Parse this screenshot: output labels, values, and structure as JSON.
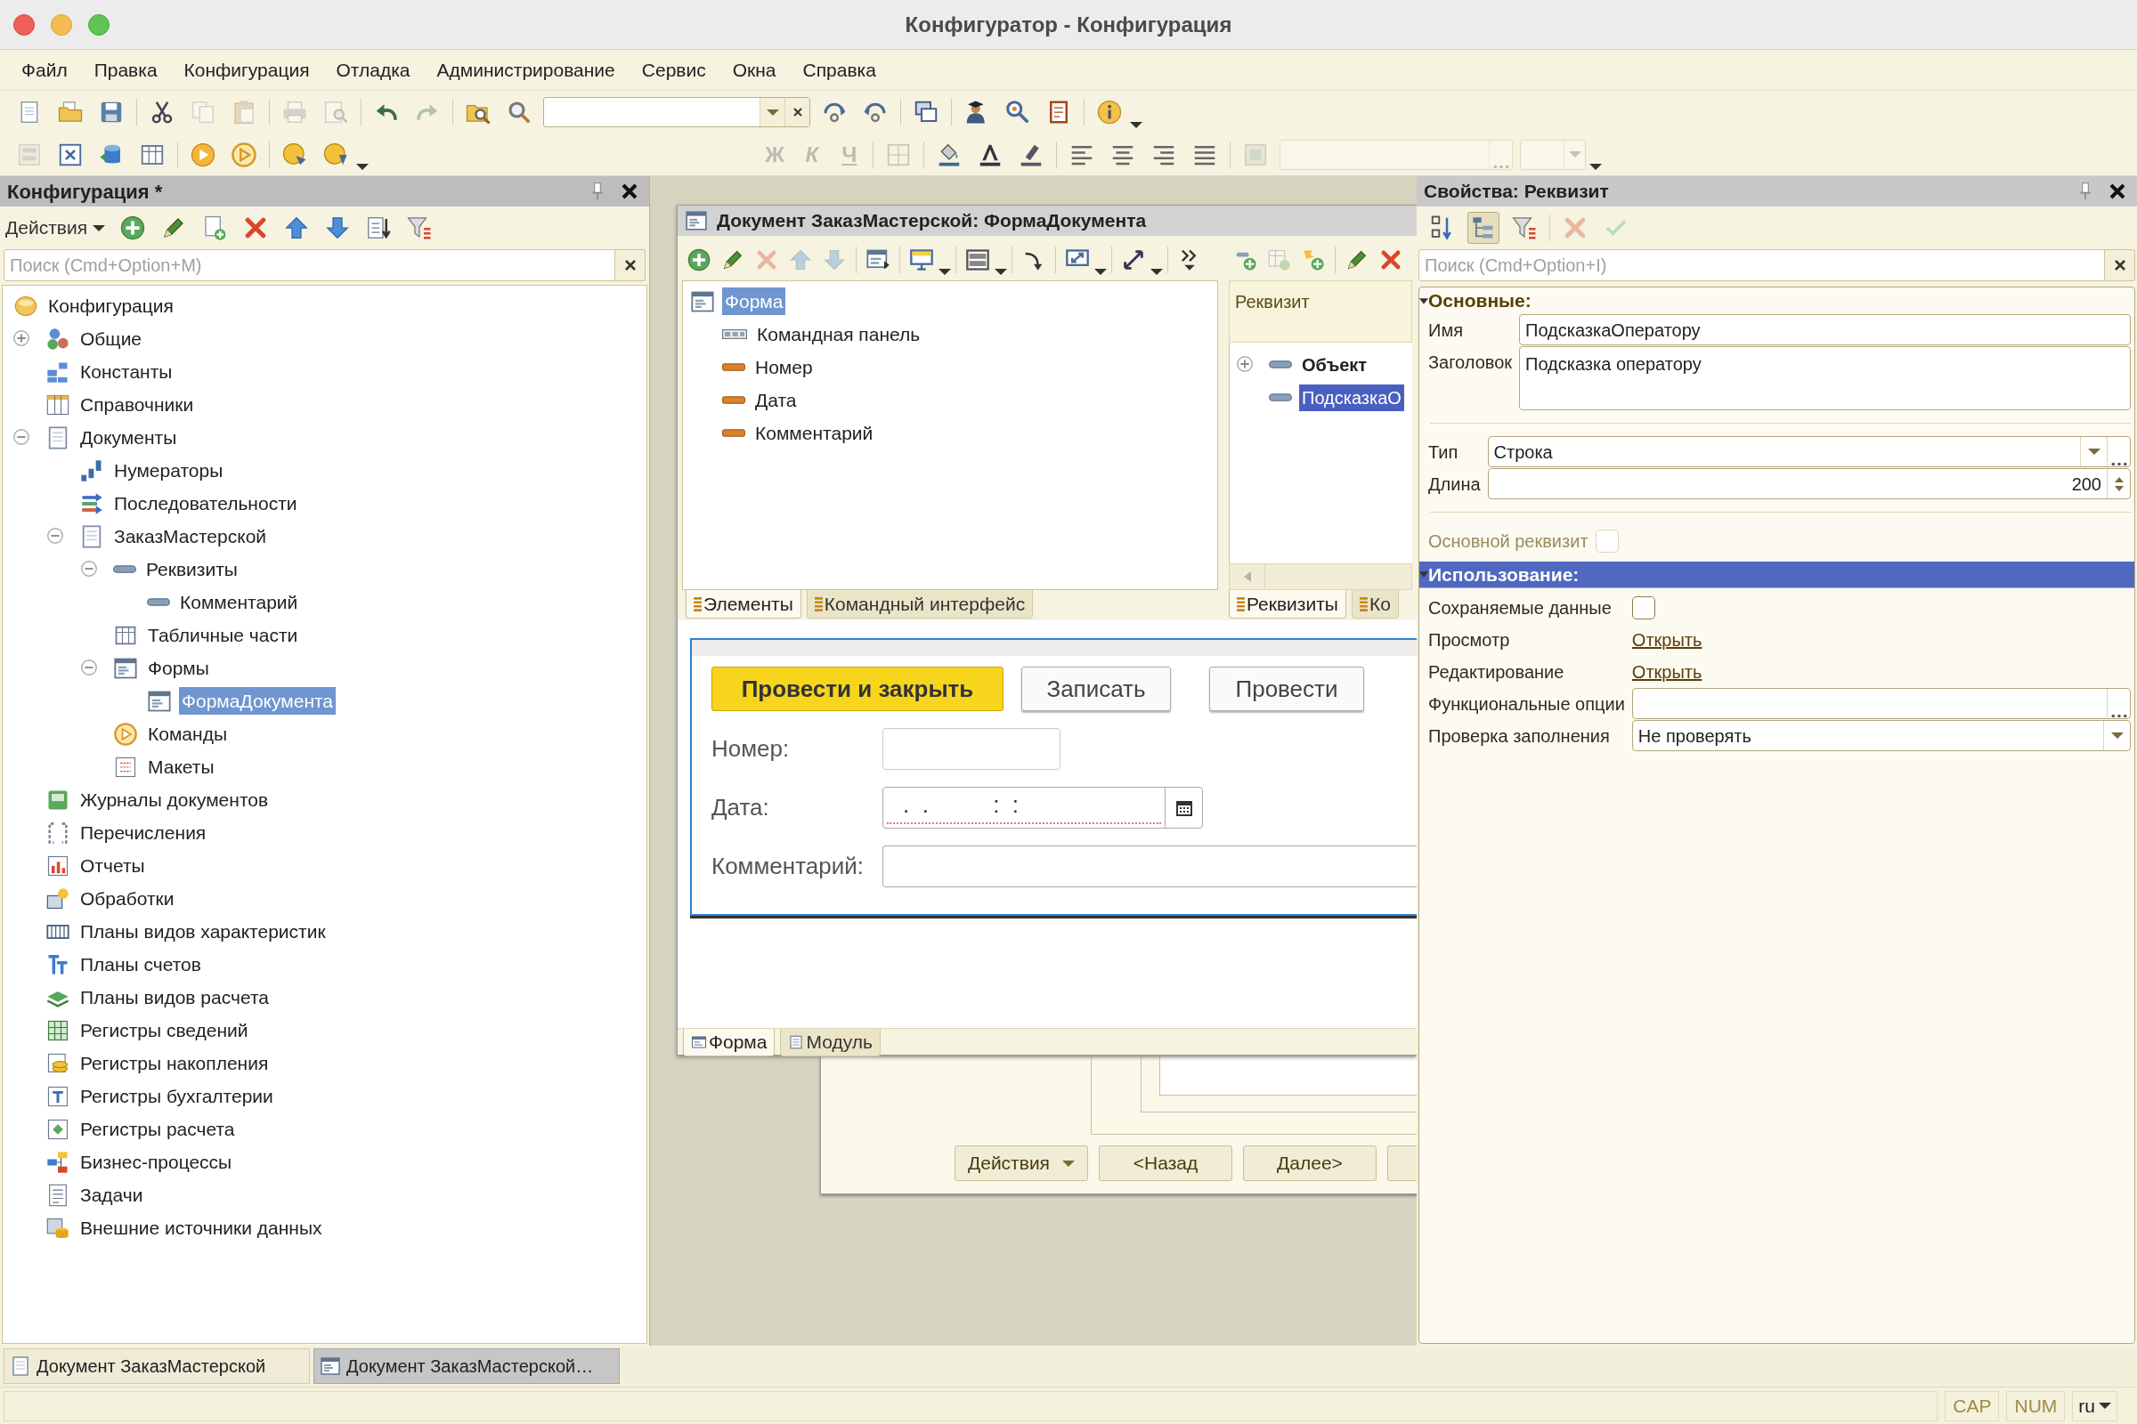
{
  "window": {
    "title": "Конфигуратор - Конфигурация"
  },
  "menu": [
    "Файл",
    "Правка",
    "Конфигурация",
    "Отладка",
    "Администрирование",
    "Сервис",
    "Окна",
    "Справка"
  ],
  "main_toolbar": [
    [
      {
        "kind": "new",
        "disabled": false
      },
      {
        "kind": "open",
        "disabled": false
      },
      {
        "kind": "save",
        "disabled": false
      }
    ],
    [
      {
        "kind": "cut",
        "disabled": false
      },
      {
        "kind": "copy",
        "disabled": true
      },
      {
        "kind": "paste",
        "disabled": true
      }
    ],
    [
      {
        "kind": "print",
        "disabled": true
      },
      {
        "kind": "preview",
        "disabled": true
      }
    ],
    [
      {
        "kind": "undo",
        "disabled": false
      },
      {
        "kind": "redo",
        "disabled": true
      }
    ],
    [
      {
        "kind": "folder-search",
        "disabled": false
      },
      {
        "kind": "search",
        "disabled": false
      },
      {
        "kind": "search-combo",
        "disabled": false
      },
      {
        "kind": "find-next",
        "disabled": false
      },
      {
        "kind": "find-prev",
        "disabled": false
      }
    ],
    [
      {
        "kind": "windows",
        "disabled": false
      }
    ],
    [
      {
        "kind": "person",
        "disabled": false
      },
      {
        "kind": "help",
        "disabled": false
      },
      {
        "kind": "book",
        "disabled": false
      }
    ],
    [
      {
        "kind": "info",
        "disabled": false
      },
      {
        "kind": "caret",
        "disabled": false
      }
    ]
  ],
  "format_toolbar": {
    "left": [
      [
        {
          "kind": "form-layout",
          "disabled": true
        },
        {
          "kind": "x-form",
          "disabled": false
        },
        {
          "kind": "db",
          "disabled": false
        },
        {
          "kind": "table",
          "disabled": false
        }
      ],
      [
        {
          "kind": "play",
          "disabled": false
        },
        {
          "kind": "play-outline",
          "disabled": false
        }
      ],
      [
        {
          "kind": "disc",
          "disabled": false
        },
        {
          "kind": "disc-down",
          "disabled": false
        },
        {
          "kind": "caret",
          "disabled": false
        }
      ]
    ],
    "right": [
      [
        {
          "kind": "bold",
          "text": "Ж",
          "disabled": true
        },
        {
          "kind": "italic",
          "text": "К",
          "disabled": true
        },
        {
          "kind": "underline",
          "text": "Ч",
          "disabled": true
        }
      ],
      [
        {
          "kind": "grid",
          "disabled": true
        }
      ],
      [
        {
          "kind": "bucket",
          "disabled": false
        },
        {
          "kind": "text-color",
          "disabled": false
        },
        {
          "kind": "highlighter",
          "disabled": false
        }
      ],
      [
        {
          "kind": "align-left",
          "disabled": false
        },
        {
          "kind": "align-center",
          "disabled": false
        },
        {
          "kind": "align-right",
          "disabled": false
        },
        {
          "kind": "align-justify",
          "disabled": false
        }
      ],
      [
        {
          "kind": "frame",
          "disabled": true
        },
        {
          "kind": "text-ellipsis",
          "disabled": true
        },
        {
          "kind": "combo-small",
          "disabled": true
        },
        {
          "kind": "caret",
          "disabled": false
        }
      ]
    ]
  },
  "config_panel": {
    "title": "Конфигурация *",
    "actions_label": "Действия",
    "toolbar": [
      [
        {
          "kind": "plus",
          "disabled": false
        },
        {
          "kind": "pencil",
          "disabled": false
        },
        {
          "kind": "doc-add",
          "disabled": false
        },
        {
          "kind": "delete",
          "disabled": false
        },
        {
          "kind": "up",
          "disabled": false
        },
        {
          "kind": "down",
          "disabled": false
        },
        {
          "kind": "list-down",
          "disabled": false
        },
        {
          "kind": "filter",
          "disabled": false
        }
      ]
    ],
    "search": {
      "placeholder": "Поиск (Cmd+Option+M)"
    },
    "tree": [
      {
        "kind": "config",
        "label": "Конфигурация",
        "selected": false,
        "children": [
          {
            "kind": "common",
            "label": "Общие",
            "expanded": false,
            "selected": false
          },
          {
            "kind": "constants",
            "label": "Константы",
            "selected": false
          },
          {
            "kind": "catalogs",
            "label": "Справочники",
            "selected": false
          },
          {
            "kind": "documents",
            "label": "Документы",
            "expanded": true,
            "selected": false,
            "children": [
              {
                "kind": "numerators",
                "label": "Нумераторы",
                "selected": false
              },
              {
                "kind": "sequences",
                "label": "Последовательности",
                "selected": false
              },
              {
                "kind": "document",
                "label": "ЗаказМастерской",
                "expanded": true,
                "selected": false,
                "children": [
                  {
                    "kind": "attributes",
                    "label": "Реквизиты",
                    "expanded": true,
                    "selected": false,
                    "children": [
                      {
                        "kind": "attribute",
                        "label": "Комментарий",
                        "selected": false
                      }
                    ]
                  },
                  {
                    "kind": "tabular",
                    "label": "Табличные части",
                    "selected": false
                  },
                  {
                    "kind": "forms",
                    "label": "Формы",
                    "expanded": true,
                    "selected": false,
                    "children": [
                      {
                        "kind": "form",
                        "label": "ФормаДокумента",
                        "selected": true
                      }
                    ]
                  },
                  {
                    "kind": "commands",
                    "label": "Команды",
                    "selected": false
                  },
                  {
                    "kind": "templates",
                    "label": "Макеты",
                    "selected": false
                  }
                ]
              }
            ]
          },
          {
            "kind": "journals",
            "label": "Журналы документов",
            "selected": false
          },
          {
            "kind": "enums",
            "label": "Перечисления",
            "selected": false
          },
          {
            "kind": "reports",
            "label": "Отчеты",
            "selected": false
          },
          {
            "kind": "processing",
            "label": "Обработки",
            "selected": false
          },
          {
            "kind": "chart-characteristics",
            "label": "Планы видов характеристик",
            "selected": false
          },
          {
            "kind": "chart-accounts",
            "label": "Планы счетов",
            "selected": false
          },
          {
            "kind": "chart-calculation",
            "label": "Планы видов расчета",
            "selected": false
          },
          {
            "kind": "info-registers",
            "label": "Регистры сведений",
            "selected": false
          },
          {
            "kind": "accumulation-registers",
            "label": "Регистры накопления",
            "selected": false
          },
          {
            "kind": "accounting-registers",
            "label": "Регистры бухгалтерии",
            "selected": false
          },
          {
            "kind": "calculation-registers",
            "label": "Регистры расчета",
            "selected": false
          },
          {
            "kind": "business-processes",
            "label": "Бизнес-процессы",
            "selected": false
          },
          {
            "kind": "tasks",
            "label": "Задачи",
            "selected": false
          },
          {
            "kind": "external-sources",
            "label": "Внешние источники данных",
            "selected": false
          }
        ]
      }
    ]
  },
  "document_window": {
    "title": "Документ ЗаказМастерской: ФормаДокумента",
    "elements_toolbar": [
      [
        {
          "kind": "plus",
          "disabled": false
        },
        {
          "kind": "pencil",
          "disabled": false
        },
        {
          "kind": "delete",
          "disabled": true
        },
        {
          "kind": "up",
          "disabled": true
        },
        {
          "kind": "down",
          "disabled": true
        }
      ],
      [
        {
          "kind": "form-items",
          "disabled": false
        }
      ],
      [
        {
          "kind": "monitor",
          "disabled": false
        },
        {
          "kind": "caret",
          "disabled": false
        }
      ],
      [
        {
          "kind": "panel",
          "disabled": false
        },
        {
          "kind": "caret",
          "disabled": false
        }
      ],
      [
        {
          "kind": "curve",
          "disabled": false
        }
      ],
      [
        {
          "kind": "resize",
          "disabled": false
        },
        {
          "kind": "caret",
          "disabled": false
        }
      ],
      [
        {
          "kind": "diag",
          "disabled": false
        },
        {
          "kind": "caret",
          "disabled": false
        }
      ],
      [
        {
          "kind": "more",
          "disabled": false
        }
      ]
    ],
    "elements": [
      {
        "kind": "form",
        "label": "Форма",
        "selected": true,
        "children": [
          {
            "kind": "command-bar",
            "label": "Командная панель",
            "selected": false
          },
          {
            "kind": "input",
            "label": "Номер",
            "selected": false
          },
          {
            "kind": "input",
            "label": "Дата",
            "selected": false
          },
          {
            "kind": "input",
            "label": "Комментарий",
            "selected": false
          }
        ]
      }
    ],
    "element_tabs": [
      {
        "label": "Элементы",
        "selected": true
      },
      {
        "label": "Командный интерфейс",
        "selected": false
      }
    ],
    "attributes_toolbar": [
      [
        {
          "kind": "attr-add",
          "disabled": false
        },
        {
          "kind": "table-add",
          "disabled": true
        },
        {
          "kind": "item-add",
          "disabled": false
        }
      ],
      [
        {
          "kind": "pencil",
          "disabled": false
        },
        {
          "kind": "delete",
          "disabled": false
        }
      ]
    ],
    "attributes_header": "Реквизит",
    "attributes": [
      {
        "kind": "object",
        "label": "Объект",
        "expanded": false,
        "selected": false
      },
      {
        "kind": "attribute",
        "label": "ПодсказкаО",
        "selected": true
      }
    ],
    "attribute_tabs": [
      {
        "label": "Реквизиты",
        "selected": true
      },
      {
        "label": "Ко",
        "selected": false
      }
    ],
    "form_preview": {
      "buttons": [
        {
          "label": "Провести и закрыть",
          "default": true
        },
        {
          "label": "Записать",
          "default": false
        },
        {
          "label": "Провести",
          "default": false
        }
      ],
      "fields": [
        {
          "kind": "text",
          "label": "Номер:"
        },
        {
          "kind": "date",
          "label": "Дата:",
          "value": ".  .          :  :"
        },
        {
          "kind": "text-wide",
          "label": "Комментарий:"
        }
      ]
    },
    "bottom_tabs": [
      {
        "label": "Форма",
        "selected": true
      },
      {
        "label": "Модуль",
        "selected": false
      }
    ]
  },
  "background_dialog": {
    "buttons": [
      {
        "label": "Действия",
        "dropdown": true
      },
      {
        "label": "<Назад",
        "dropdown": false
      },
      {
        "label": "Далее>",
        "dropdown": false
      }
    ]
  },
  "properties": {
    "title": "Свойства: Реквизит",
    "toolbar": [
      [
        {
          "kind": "sort",
          "disabled": false,
          "pressed": false
        },
        {
          "kind": "treeview",
          "disabled": false,
          "pressed": true
        },
        {
          "kind": "filter",
          "disabled": false,
          "pressed": false
        }
      ],
      [
        {
          "kind": "delete",
          "disabled": true,
          "pressed": false
        },
        {
          "kind": "check",
          "disabled": true,
          "pressed": false
        }
      ]
    ],
    "search": {
      "placeholder": "Поиск (Cmd+Option+I)"
    },
    "sections": [
      {
        "title": "Основные:",
        "expanded": true,
        "selected": false,
        "groups": [
          [
            {
              "kind": "text",
              "label": "Имя",
              "value": "ПодсказкаОператору"
            },
            {
              "kind": "textarea",
              "label": "Заголовок",
              "value": "Подсказка оператору"
            }
          ],
          [
            {
              "kind": "combo-ellipsis",
              "label": "Тип",
              "value": "Строка"
            },
            {
              "kind": "number",
              "label": "Длина",
              "value": "200"
            }
          ],
          [
            {
              "kind": "checkbox",
              "label": "Основной реквизит",
              "checked": false,
              "disabled": true
            }
          ]
        ]
      },
      {
        "title": "Использование:",
        "expanded": true,
        "selected": true,
        "groups": [
          [
            {
              "kind": "checkbox",
              "label": "Сохраняемые данные",
              "checked": false,
              "disabled": false
            },
            {
              "kind": "link",
              "label": "Просмотр",
              "value": "Открыть"
            },
            {
              "kind": "link",
              "label": "Редактирование",
              "value": "Открыть"
            },
            {
              "kind": "ellipsis",
              "label": "Функциональные опции"
            },
            {
              "kind": "combo",
              "label": "Проверка заполнения",
              "value": "Не проверять"
            }
          ]
        ]
      }
    ]
  },
  "taskbar": [
    {
      "kind": "document",
      "label": "Документ ЗаказМастерской",
      "selected": false
    },
    {
      "kind": "form",
      "label": "Документ ЗаказМастерской…",
      "selected": true
    }
  ],
  "status_bar": {
    "indicators": [
      {
        "label": "CAP",
        "on": false
      },
      {
        "label": "NUM",
        "on": false
      }
    ],
    "language": "ru"
  }
}
